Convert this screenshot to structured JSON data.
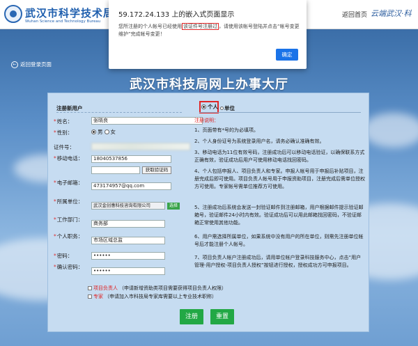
{
  "header": {
    "logo_cn": "武汉市科学技术局",
    "logo_en": "Wuhan Science and Technology Bureau",
    "home_link": "返回首页",
    "slogan": "云端武汉·科"
  },
  "page": {
    "back_link": "返回登录页面",
    "title": "武汉市科技局网上办事大厅"
  },
  "form": {
    "section_title": "注册新用户",
    "fields": {
      "name_label": "姓名",
      "name_value": "张晓良",
      "gender_label": "性别",
      "gender_male": "男",
      "gender_female": "女",
      "idcard_label": "证件号",
      "phone_label": "移动电话",
      "phone_value": "18040537856",
      "get_code_label": "获取验证码",
      "email_label": "电子邮箱",
      "email_value": "473174957@qq.com",
      "unit_label": "所属单位",
      "unit_value": "武汉金创惠科技咨询有限公司",
      "select_label": "选择",
      "department_label": "工作部门",
      "department_value": "商务部",
      "position_label": "个人职务",
      "position_value": "市场区域总监",
      "password_label": "密码",
      "password_value": "••••••",
      "confirm_label": "确认密码",
      "confirm_value": "••••••"
    },
    "checkbox_leader_red": "项目负责人",
    "checkbox_leader_note": "（申请新增资助类项目需要获得项目负责人权限）",
    "checkbox_expert_red": "专家",
    "checkbox_expert_note": "（申请加入市科技局专家库需要以上专业技术职称）",
    "register_button": "注册",
    "reset_button": "重置"
  },
  "tabs": {
    "personal": "个人",
    "unit": "单位"
  },
  "notes": {
    "title": "注册说明：",
    "items": [
      "1、页面带有*号的为必填项。",
      "2、个人身份证号为系统登录用户名，请务必确认准确有效。",
      "3、移动电话为11位有效号码，注册成功后可以移动电话验证，以确保联系方式正确有效，验证成功后用户可使用移动电话找回密码。",
      "4、个人包括申报人、项目负责人和专家。申报人帐号用于申报后补贴项目，注册完成后即可使用。项目负责人帐号用于申报资助项目，注册完成后需单位授权方可使用。专家帐号需单位推荐方可使用。",
      "5、注册成功后系统会发送一封验证邮件到注册邮箱，用户根据邮件提示验证邮箱号，验证邮件24小时内有效。验证成功后可以用此邮箱找回密码，不验证邮箱正常使用其他功能。",
      "6、用户需选择所属单位，如果系统中没有用户的所在单位，则需先注册单位帐号后才能注册个人帐号。",
      "7、项目负责人帐户注册成功后，请用单位帐户登录科技服务中心，点击“用户管理-用户授权-项目负责人授权”按钮进行授权，授权成功方可申报项目。"
    ]
  },
  "dialog": {
    "title": "59.172.24.133 上的嵌入式页面显示",
    "text_before": "您所注册的个人帐号已经使用",
    "text_highlight": "该证件号注册过",
    "text_after": "，请使用该帐号登陆并点击“帐号变更维护”完成帐号变更！",
    "ok_button": "确定"
  }
}
